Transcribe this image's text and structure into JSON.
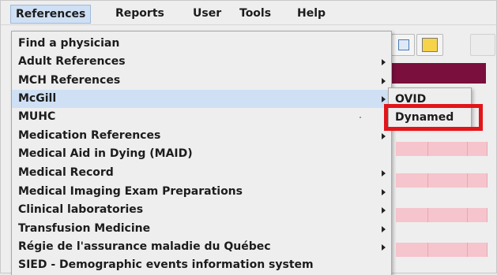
{
  "menubar": {
    "items": [
      "References",
      "Reports",
      "User",
      "Tools",
      "Help"
    ]
  },
  "menu": {
    "items": [
      {
        "label": "Find a physician",
        "has_submenu": false
      },
      {
        "label": "Adult References",
        "has_submenu": true
      },
      {
        "label": "MCH References",
        "has_submenu": true
      },
      {
        "label": "McGill",
        "has_submenu": true,
        "selected": true
      },
      {
        "label": "MUHC",
        "has_submenu": false
      },
      {
        "label": "Medication References",
        "has_submenu": true
      },
      {
        "label": "Medical Aid in Dying (MAID)",
        "has_submenu": false
      },
      {
        "label": "Medical Record",
        "has_submenu": true
      },
      {
        "label": "Medical Imaging Exam Preparations",
        "has_submenu": true
      },
      {
        "label": "Clinical laboratories",
        "has_submenu": true
      },
      {
        "label": "Transfusion Medicine",
        "has_submenu": true
      },
      {
        "label": "Régie de l'assurance maladie du Québec",
        "has_submenu": true
      },
      {
        "label": "SIED - Demographic events information system",
        "has_submenu": false
      }
    ]
  },
  "submenu": {
    "items": [
      "OVID",
      "Dynamed"
    ]
  },
  "colors": {
    "highlight_border": "#e2151a",
    "selection": "#cfe0f4",
    "maroon": "#7a0f3d",
    "pink_rows": "#f6c4cc"
  },
  "icons": [
    "toolbar-button-icon",
    "document-stack-icon",
    "submenu-arrow-icon"
  ]
}
